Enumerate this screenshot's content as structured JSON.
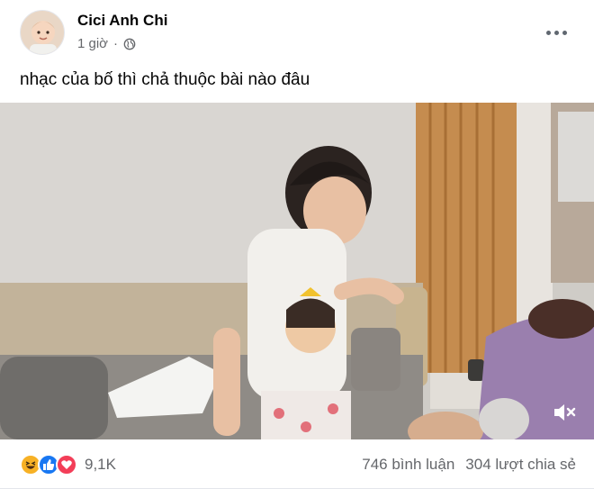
{
  "post": {
    "author": "Cici Anh Chi",
    "time": "1 giờ",
    "privacy_icon": "globe-icon",
    "more_icon": "more-options-icon",
    "caption": "nhạc của bố thì chả thuộc bài nào đâu"
  },
  "video": {
    "mute_icon": "volume-muted-icon"
  },
  "footer": {
    "reactions": [
      "haha-icon",
      "like-icon",
      "love-icon"
    ],
    "reaction_count": "9,1K",
    "comments": "746 bình luận",
    "shares": "304 lượt chia sẻ"
  },
  "colors": {
    "like": "#1877f2",
    "love": "#f33e58",
    "haha": "#f7b125",
    "secondary_text": "#65676b"
  }
}
